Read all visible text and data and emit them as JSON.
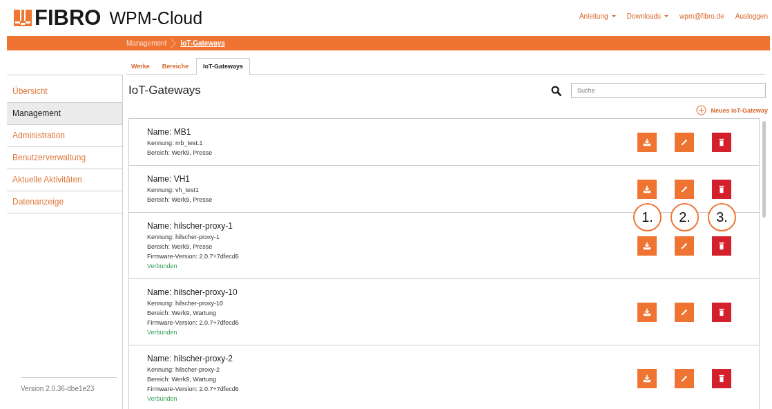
{
  "header": {
    "logo": "FIBRO",
    "app_name": "WPM-Cloud",
    "nav": [
      {
        "label": "Anleitung",
        "dropdown": true
      },
      {
        "label": "Downloads",
        "dropdown": true
      },
      {
        "label": "wpm@fibro.de",
        "dropdown": false
      },
      {
        "label": "Ausloggen",
        "dropdown": false
      }
    ]
  },
  "breadcrumb": [
    {
      "label": "Management",
      "current": false
    },
    {
      "label": "IoT-Gateways",
      "current": true
    }
  ],
  "tabs": [
    {
      "label": "Werke",
      "selected": false
    },
    {
      "label": "Bereiche",
      "selected": false
    },
    {
      "label": "IoT-Gateways",
      "selected": true
    }
  ],
  "sidebar": {
    "items": [
      {
        "label": "Übersicht",
        "selected": false
      },
      {
        "label": "Management",
        "selected": true
      },
      {
        "label": "Administration",
        "selected": false
      },
      {
        "label": "Benutzerverwaltung",
        "selected": false
      },
      {
        "label": "Aktuelle Aktivitäten",
        "selected": false
      },
      {
        "label": "Datenanzeige",
        "selected": false
      }
    ],
    "version": "Version 2.0.36-dbe1e23"
  },
  "page_title": "IoT-Gateways",
  "search": {
    "placeholder": "Suche"
  },
  "new_button": "Neues IoT-Gateway",
  "gateways": [
    {
      "name": "Name: MB1",
      "kennung": "Kennung: mb_test.1",
      "bereich": "Bereich: Werk9, Presse"
    },
    {
      "name": "Name: VH1",
      "kennung": "Kennung: vh_test1",
      "bereich": "Bereich: Werk9, Presse"
    },
    {
      "name": "Name: hilscher-proxy-1",
      "kennung": "Kennung: hilscher-proxy-1",
      "bereich": "Bereich: Werk9, Presse",
      "firmware": "Firmware-Version: 2.0.7+7dfecd6",
      "status": "Verbunden"
    },
    {
      "name": "Name: hilscher-proxy-10",
      "kennung": "Kennung: hilscher-proxy-10",
      "bereich": "Bereich: Werk9, Wartung",
      "firmware": "Firmware-Version: 2.0.7+7dfecd6",
      "status": "Verbunden"
    },
    {
      "name": "Name: hilscher-proxy-2",
      "kennung": "Kennung: hilscher-proxy-2",
      "bereich": "Bereich: Werk9, Wartung",
      "firmware": "Firmware-Version: 2.0.7+7dfecd6",
      "status": "Verbunden"
    }
  ],
  "callouts": [
    "1.",
    "2.",
    "3."
  ]
}
